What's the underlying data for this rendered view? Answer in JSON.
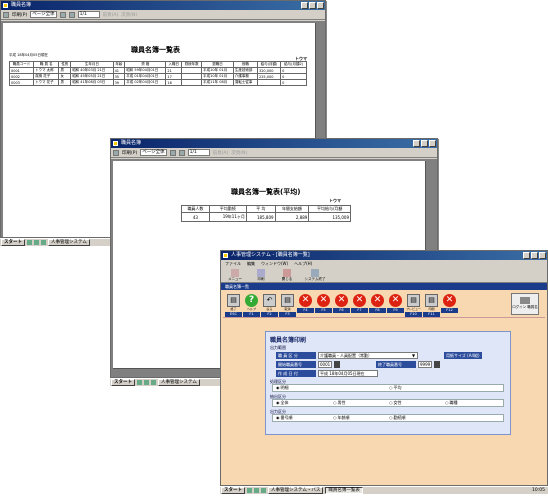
{
  "win1": {
    "title": "職員名簿",
    "toolbar": {
      "print": "印刷(P)",
      "zoom": "ページ全体",
      "page": "1/1",
      "prev": "前頁(A)",
      "next": "次頁(N)"
    },
    "report": {
      "title": "職員名簿一覧表",
      "date": "平成 18年04月05日現在",
      "company": "トウマ",
      "headers": [
        "職員コード",
        "職 員 名",
        "性別",
        "生年月日",
        "年齢",
        "資 格",
        "入職日",
        "勤続年数",
        "退職日",
        "役職",
        "給与(月額)",
        "給与(月額2)"
      ],
      "rows": [
        [
          "0001",
          "トウマ 太郎",
          "男",
          "昭和 40年03月 21日",
          "41",
          "昭和 59年04月01日",
          "21",
          "",
          "平成10年 01月",
          "生産技術部",
          "320,000",
          "0"
        ],
        [
          "0002",
          "真鍋 花子",
          "女",
          "昭和 45年05月 21日",
          "35",
          "平成 01年04月01日",
          "17",
          "",
          "平成10年 01月",
          "介護事務",
          "225,000",
          "0"
        ],
        [
          "0003",
          "トウマ 花子",
          "男",
          "昭和 41年08月 03日",
          "39",
          "平成 02年04月01日",
          "16",
          "",
          "平成11年 08月",
          "運転士従事",
          "",
          "0"
        ]
      ]
    }
  },
  "win2": {
    "title": "職員名簿",
    "toolbar": {
      "print": "印刷(P)",
      "zoom": "ページ全体",
      "page": "1/1",
      "prev": "前頁(A)",
      "next": "次頁(N)"
    },
    "report": {
      "title": "職員名簿一覧表(平均)",
      "company": "トウマ",
      "headers": [
        "職員人数",
        "平均勤続",
        "平 均",
        "年間支給額",
        "平均給与/月額"
      ],
      "row": [
        "43",
        "19年11ヶ月",
        "185,809",
        "2,889",
        "135,009"
      ]
    }
  },
  "win3": {
    "title": "人事管理システム - [職員名簿一覧]",
    "menu": [
      "ファイル",
      "編集",
      "ウィンドウ(W)",
      "ヘルプ(H)"
    ],
    "top_tabs": [
      "メニュー",
      "印刷",
      "開じる",
      "システム終了"
    ],
    "subtitle": "職員名簿一覧",
    "fkeys": [
      {
        "key": "ESC",
        "label": "終了",
        "kind": "sq"
      },
      {
        "key": "F1",
        "label": "ヘルプ",
        "kind": "help"
      },
      {
        "key": "F2",
        "label": "戻る",
        "kind": "arrow"
      },
      {
        "key": "F3",
        "label": "取消",
        "kind": "sq"
      },
      {
        "key": "F4",
        "label": "",
        "kind": "x"
      },
      {
        "key": "F5",
        "label": "",
        "kind": "x"
      },
      {
        "key": "F6",
        "label": "",
        "kind": "x"
      },
      {
        "key": "F7",
        "label": "",
        "kind": "x"
      },
      {
        "key": "F8",
        "label": "",
        "kind": "x"
      },
      {
        "key": "F9",
        "label": "",
        "kind": "x"
      },
      {
        "key": "F10",
        "label": "プレビュー",
        "kind": "sq"
      },
      {
        "key": "F11",
        "label": "印刷",
        "kind": "sq"
      },
      {
        "key": "F12",
        "label": "",
        "kind": "x"
      }
    ],
    "right_panel": "ログイン 職員名",
    "form": {
      "title": "職員名簿印刷",
      "section_output": "出力範囲",
      "label_kubun": "職 員 区 分",
      "kubun_value": "介護職員・人員配置（常勤）",
      "paper_size_label": "用紙サイズ (A4縦)",
      "label_start": "開始職員番号",
      "start_value": "0001",
      "label_end": "終了職員番号",
      "end_value": "9999",
      "label_date": "作 成 日 付",
      "date_value": "平成 18年04月05日現在",
      "group_proc": "処理区分",
      "proc": [
        "明細",
        "平均"
      ],
      "group_output": "抽出区分",
      "output": [
        "全体",
        "男性",
        "女性",
        "職種"
      ],
      "group_print": "出力区分",
      "print": [
        "番号順",
        "年齢順",
        "勤続順"
      ]
    }
  },
  "taskbars": {
    "start": "スタート",
    "t1": "人事管理システム",
    "t2": "人事管理システム",
    "t3a": "人事管理システム・バス",
    "t3b": "職員名簿一覧表",
    "clock": "10:05"
  }
}
